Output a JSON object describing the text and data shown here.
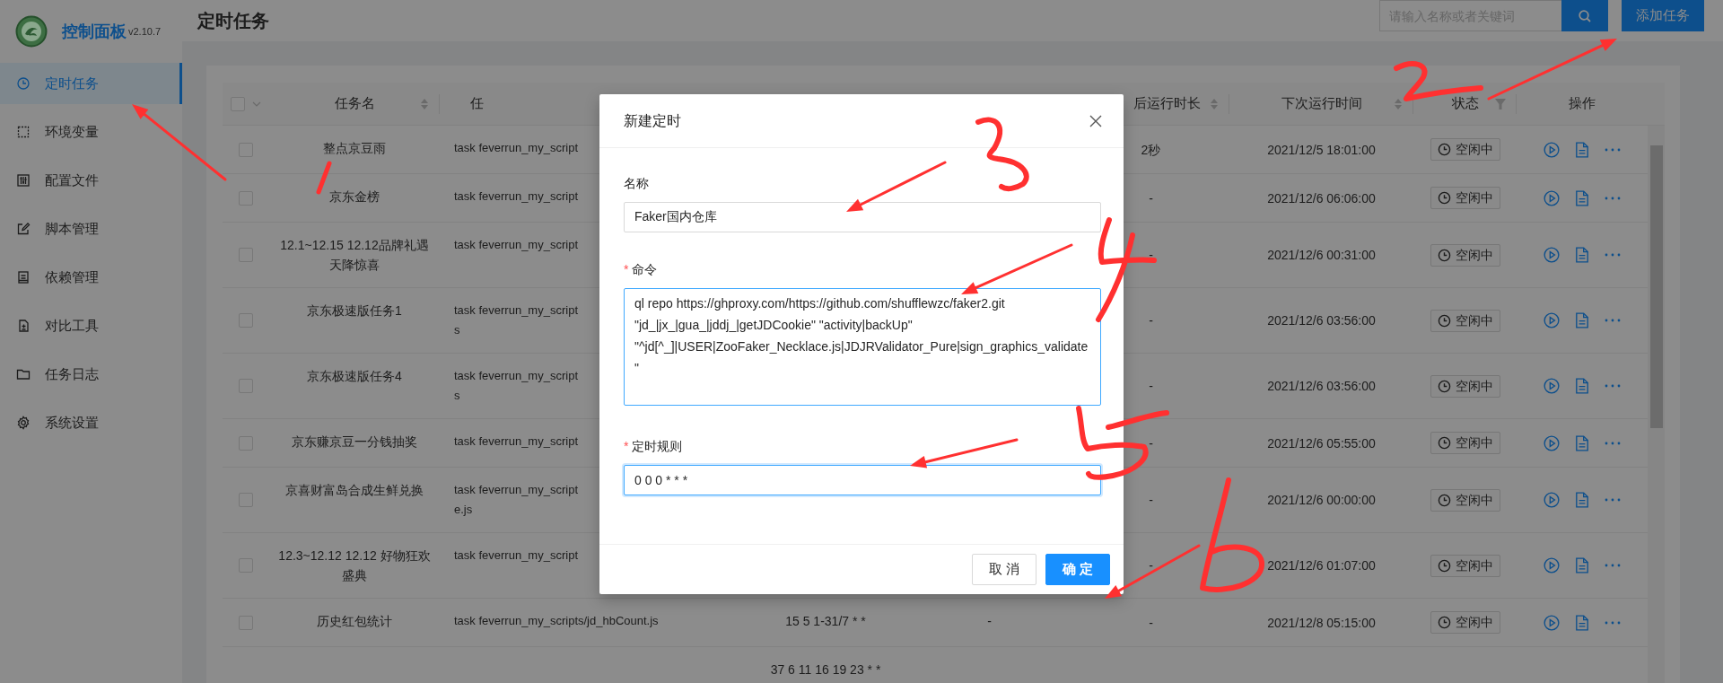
{
  "sidebar": {
    "brand": "控制面板",
    "version": "v2.10.7",
    "items": [
      {
        "label": "定时任务",
        "selected": true
      },
      {
        "label": "环境变量",
        "selected": false
      },
      {
        "label": "配置文件",
        "selected": false
      },
      {
        "label": "脚本管理",
        "selected": false
      },
      {
        "label": "依赖管理",
        "selected": false
      },
      {
        "label": "对比工具",
        "selected": false
      },
      {
        "label": "任务日志",
        "selected": false
      },
      {
        "label": "系统设置",
        "selected": false
      }
    ]
  },
  "header": {
    "title": "定时任务",
    "search": {
      "placeholder": "请输入名称或者关键词"
    },
    "add_button": "添加任务"
  },
  "table": {
    "select_all": {
      "checked": false
    },
    "columns": [
      {
        "label": "任务名"
      },
      {
        "label": "任"
      },
      {
        "label": "后运行时长"
      },
      {
        "label": "下次运行时间"
      },
      {
        "label": "状态"
      },
      {
        "label": "操作"
      }
    ],
    "rows": [
      {
        "checked": false,
        "name": "整点京豆雨",
        "command": [
          "task feverrun_my_script"
        ],
        "duration": "2秒",
        "next_run": "2021/12/5 18:01:00",
        "status": "空闲中"
      },
      {
        "checked": false,
        "name": "京东金榜",
        "command": [
          "task feverrun_my_script"
        ],
        "duration": "-",
        "next_run": "2021/12/6 06:06:00",
        "status": "空闲中"
      },
      {
        "checked": false,
        "name": "12.1~12.15 12.12品牌礼遇天降惊喜",
        "command": [
          "task feverrun_my_script"
        ],
        "duration": "-",
        "next_run": "2021/12/6 00:31:00",
        "status": "空闲中"
      },
      {
        "checked": false,
        "name": "京东极速版任务1",
        "command": [
          "task feverrun_my_script",
          "s"
        ],
        "duration": "-",
        "next_run": "2021/12/6 03:56:00",
        "status": "空闲中"
      },
      {
        "checked": false,
        "name": "京东极速版任务4",
        "command": [
          "task feverrun_my_script",
          "s"
        ],
        "duration": "-",
        "next_run": "2021/12/6 03:56:00",
        "status": "空闲中"
      },
      {
        "checked": false,
        "name": "京东赚京豆一分钱抽奖",
        "command": [
          "task feverrun_my_script"
        ],
        "duration": "-",
        "next_run": "2021/12/6 05:55:00",
        "status": "空闲中"
      },
      {
        "checked": false,
        "name": "京喜财富岛合成生鲜兑换",
        "command": [
          "task feverrun_my_script",
          "e.js"
        ],
        "duration": "-",
        "next_run": "2021/12/6 00:00:00",
        "status": "空闲中"
      },
      {
        "checked": false,
        "name": "12.3~12.12 12.12 好物狂欢盛典",
        "command": [
          "task feverrun_my_script"
        ],
        "duration": "-",
        "next_run": "2021/12/6 01:07:00",
        "status": "空闲中"
      },
      {
        "checked": false,
        "name": "历史红包统计",
        "command": [
          "task feverrun_my_scripts/jd_hbCount.js"
        ],
        "schedule": "15 5 1-31/7 * *",
        "last_run": "-",
        "duration": "-",
        "next_run": "2021/12/8 05:15:00",
        "status": "空闲中"
      },
      {
        "schedule": "37 6 11 16 19 23 * *"
      }
    ]
  },
  "dialog": {
    "title": "新建定时",
    "fields": [
      {
        "kind": "input",
        "label": "名称",
        "value": "Faker国内仓库",
        "highlighted": false
      },
      {
        "kind": "textarea",
        "required_mark": "*",
        "label": "命令",
        "value": "ql repo https://ghproxy.com/https://github.com/shufflewzc/faker2.git \"jd_|jx_|gua_|jddj_|getJDCookie\" \"activity|backUp\" \"^jd[^_]|USER|ZooFaker_Necklace.js|JDJRValidator_Pure|sign_graphics_validate\"",
        "highlighted": true
      },
      {
        "kind": "input",
        "required_mark": "*",
        "label": "定时规则",
        "value": "0 0 0 * * *",
        "highlighted": true
      }
    ],
    "buttons": [
      {
        "label": "取 消",
        "primary": false
      },
      {
        "label": "确 定",
        "primary": true
      }
    ]
  }
}
